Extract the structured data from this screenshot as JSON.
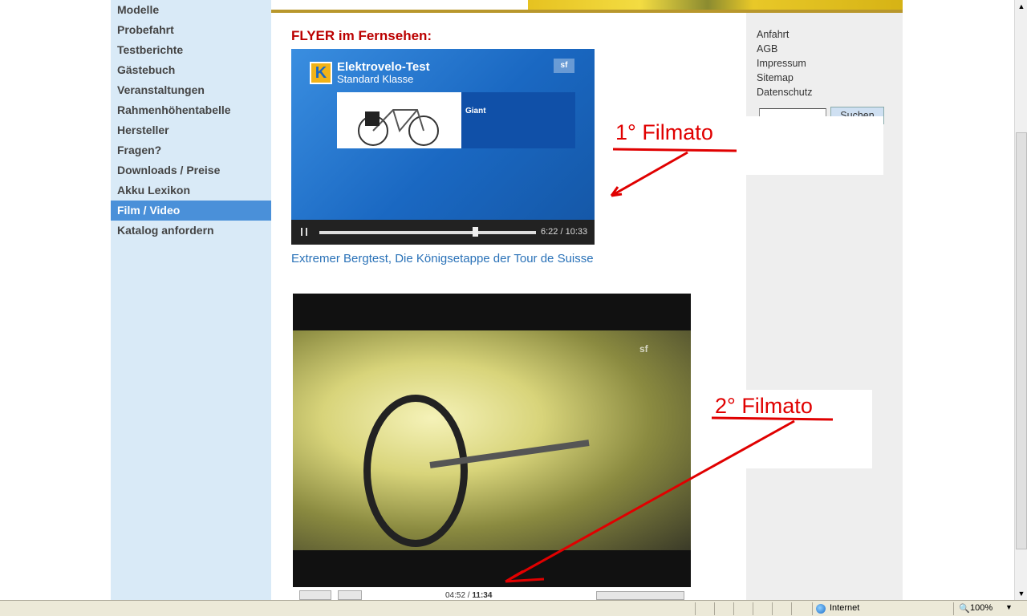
{
  "sidebar": {
    "items": [
      {
        "label": "Modelle"
      },
      {
        "label": "Probefahrt"
      },
      {
        "label": "Testberichte"
      },
      {
        "label": "Gästebuch"
      },
      {
        "label": "Veranstaltungen"
      },
      {
        "label": "Rahmenhöhentabelle"
      },
      {
        "label": "Hersteller"
      },
      {
        "label": "Fragen?"
      },
      {
        "label": "Downloads / Preise"
      },
      {
        "label": "Akku Lexikon"
      },
      {
        "label": "Film / Video",
        "active": true
      },
      {
        "label": "Katalog anfordern"
      }
    ]
  },
  "right_links": [
    "Anfahrt",
    "AGB",
    "Impressum",
    "Sitemap",
    "Datenschutz"
  ],
  "search": {
    "button_label": "Suchen",
    "value": ""
  },
  "main": {
    "heading": "FLYER im Fernsehen:",
    "video1": {
      "title_line1": "Elektrovelo-Test",
      "title_line2": "Standard Klasse",
      "logo_letter": "K",
      "channel": "sf",
      "card_label": "Giant",
      "time": "6:22 / 10:33",
      "progress": 0.72
    },
    "link_text": "Extremer Bergtest, Die Königsetappe der Tour de Suisse",
    "video2": {
      "channel": "sf",
      "time_elapsed": "04:52",
      "time_total": "11:34"
    }
  },
  "annotations": [
    {
      "label": "1° Filmato"
    },
    {
      "label": "2° Filmato"
    }
  ],
  "statusbar": {
    "zone": "Internet",
    "zoom": "100%"
  },
  "colors": {
    "sidebar_bg": "#d9eaf7",
    "active_item": "#4a90d9",
    "heading_red": "#b00000",
    "link_blue": "#2a72b8",
    "annotation_red": "#e00000"
  }
}
